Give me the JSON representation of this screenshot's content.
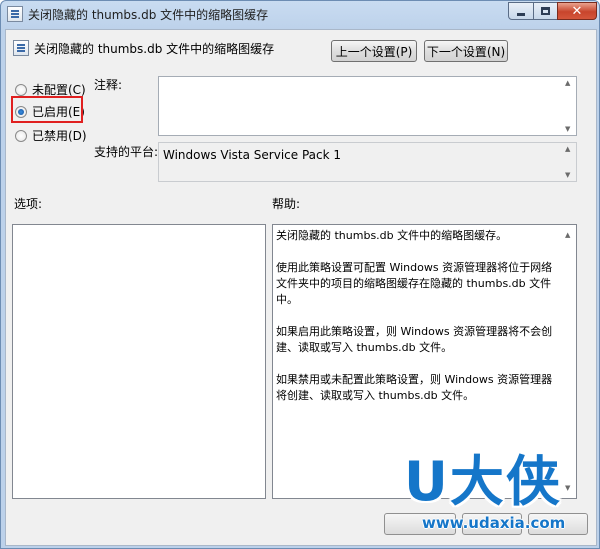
{
  "window": {
    "title": "关闭隐藏的 thumbs.db 文件中的缩略图缓存",
    "controls": {
      "minimize": "minimize-icon",
      "maximize": "maximize-icon",
      "close": "close-icon"
    }
  },
  "header": {
    "setting_name": "关闭隐藏的 thumbs.db 文件中的缩略图缓存",
    "prev_button": "上一个设置(P)",
    "next_button": "下一个设置(N)"
  },
  "state": {
    "options": [
      {
        "label": "未配置(C)",
        "checked": false
      },
      {
        "label": "已启用(E)",
        "checked": true
      },
      {
        "label": "已禁用(D)",
        "checked": false
      }
    ]
  },
  "comment": {
    "label": "注释:",
    "value": ""
  },
  "platform": {
    "label": "支持的平台:",
    "value": "Windows Vista Service Pack 1"
  },
  "options_panel": {
    "label": "选项:"
  },
  "help_panel": {
    "label": "帮助:",
    "paragraphs": [
      "关闭隐藏的 thumbs.db 文件中的缩略图缓存。",
      "使用此策略设置可配置 Windows 资源管理器将位于网络文件夹中的项目的缩略图缓存在隐藏的 thumbs.db 文件中。",
      "如果启用此策略设置，则 Windows 资源管理器将不会创建、读取或写入 thumbs.db 文件。",
      "如果禁用或未配置此策略设置，则 Windows 资源管理器将创建、读取或写入 thumbs.db 文件。"
    ]
  },
  "watermark": {
    "brand": "U大侠",
    "url": "www.udaxia.com"
  },
  "colors": {
    "highlight_box": "#e02020",
    "watermark": "#1576c9"
  }
}
